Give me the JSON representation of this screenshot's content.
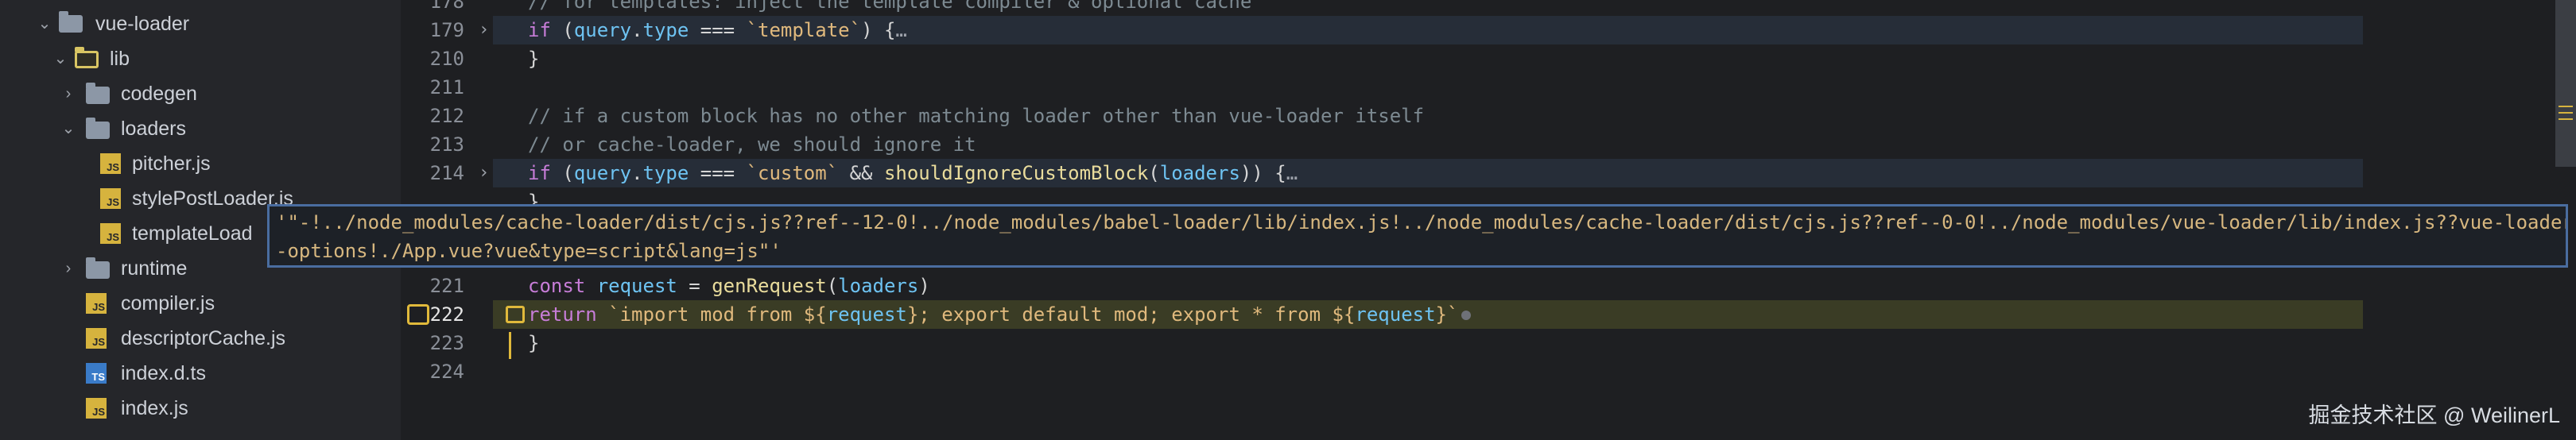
{
  "sidebar": {
    "items": [
      {
        "label": "vue-loader",
        "kind": "folder-open"
      },
      {
        "label": "lib",
        "kind": "folder-open-active"
      },
      {
        "label": "codegen",
        "kind": "folder"
      },
      {
        "label": "loaders",
        "kind": "folder-open"
      },
      {
        "label": "pitcher.js",
        "kind": "js"
      },
      {
        "label": "stylePostLoader.js",
        "kind": "js"
      },
      {
        "label": "templateLoad",
        "kind": "js"
      },
      {
        "label": "runtime",
        "kind": "folder"
      },
      {
        "label": "compiler.js",
        "kind": "js"
      },
      {
        "label": "descriptorCache.js",
        "kind": "js"
      },
      {
        "label": "index.d.ts",
        "kind": "ts"
      },
      {
        "label": "index.js",
        "kind": "js"
      }
    ]
  },
  "editor": {
    "lines": [
      {
        "num": "178",
        "text": "// for templates: inject the template compiler & optional cache"
      },
      {
        "num": "179",
        "text": "if (query.type === `template`) {…"
      },
      {
        "num": "210",
        "text": "}"
      },
      {
        "num": "211",
        "text": ""
      },
      {
        "num": "212",
        "text": "// if a custom block has no other matching loader other than vue-loader itself"
      },
      {
        "num": "213",
        "text": "// or cache-loader, we should ignore it"
      },
      {
        "num": "214",
        "text": "if (query.type === `custom` && shouldIgnoreCustomBlock(loaders)) {…"
      },
      {
        "num": "221",
        "text": "const request = genRequest(loaders)"
      },
      {
        "num": "222",
        "text": "return `import mod from ${request}; export default mod; export * from ${request}`"
      },
      {
        "num": "223",
        "text": "}"
      },
      {
        "num": "224",
        "text": ""
      }
    ],
    "tooltip": {
      "line1": "'\"-!../node_modules/cache-loader/dist/cjs.js??ref--12-0!../node_modules/babel-loader/lib/index.js!../node_modules/cache-loader/dist/cjs.js??ref--0-0!../node_modules/vue-loader/lib/index.js??vue-loader",
      "line2": "-options!./App.vue?vue&type=script&lang=js\"'"
    }
  },
  "watermark": "掘金技术社区 @ WeilinerL",
  "colors": {
    "keyword": "#c77dd8",
    "identifier": "#6ec3f2",
    "string": "#e0b97d",
    "comment": "#7d8a92",
    "breakpoint": "#e0b93b"
  }
}
